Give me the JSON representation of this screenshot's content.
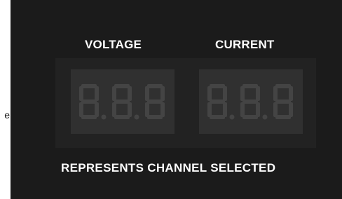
{
  "labels": {
    "voltage": "VOLTAGE",
    "current": "CURRENT"
  },
  "footer": "REPRESENTS CHANNEL SELECTED",
  "edge_text": "e",
  "displays": {
    "voltage": {
      "digits": [
        "8",
        "8",
        "8"
      ],
      "decimal_points": [
        true,
        true,
        false
      ]
    },
    "current": {
      "digits": [
        "8",
        "8",
        "8"
      ],
      "decimal_points": [
        true,
        true,
        false
      ]
    }
  },
  "colors": {
    "panel": "#1b1b1b",
    "bezel": "#222222",
    "readout_bg": "#303030",
    "segment_unlit": "#444444",
    "label": "#ffffff"
  }
}
